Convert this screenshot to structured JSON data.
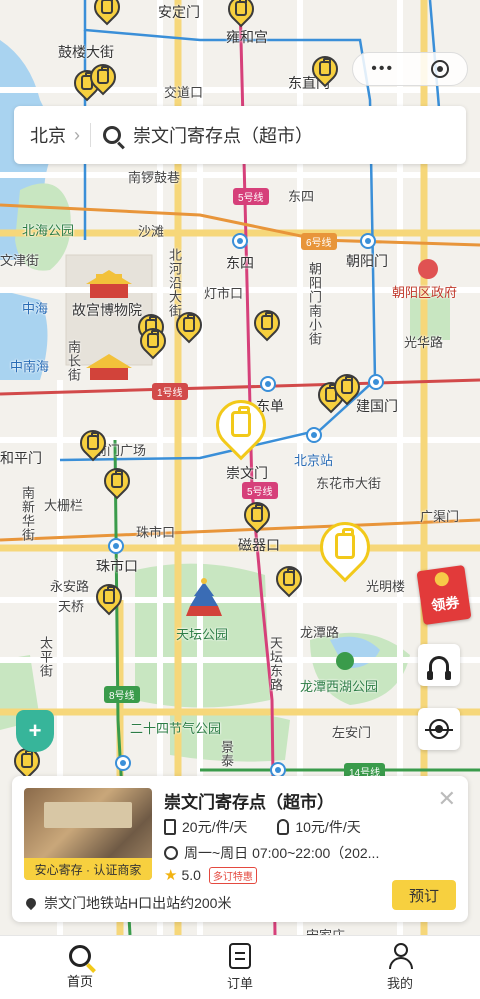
{
  "map": {
    "labels": {
      "anding_gate": "安定门",
      "yonghe_palace": "雍和宫",
      "gulou_street": "鼓楼大街",
      "jiaodaokou": "交道口",
      "dongzhimen": "东直门",
      "nanluoguxiang": "南锣鼓巷",
      "dongsi": "东四",
      "beihai_park": "北海公园",
      "shatan": "沙滩",
      "wenjin_street": "文津街",
      "beiheyan": "北河沿大街",
      "dongsi_station": "东四",
      "chaoyangmen": "朝阳门",
      "chaoyang_gov": "朝阳区政府",
      "zhonghai": "中海",
      "forbidden_city": "故宫博物院",
      "dengshikou": "灯市口",
      "chaoyangmen_nanxiaojie": "朝阳门南小街",
      "guanghualu": "光华路",
      "nanhai": "中南海",
      "nanchang_street": "南长街",
      "dongdan": "东单",
      "jianguomen": "建国门",
      "beijing_station": "北京站",
      "fuxingmen": "和平门",
      "qianmen_square": "前门广场",
      "chongwenmen": "崇文门",
      "dongbianmen": "东花市大街",
      "guangqumen": "广渠门",
      "nanxinhua": "南新华街",
      "dashilar": "大栅栏",
      "zhushikou_west": "珠市口",
      "zhushikou": "珠市口",
      "ciqikou": "磁器口",
      "yongan_road": "永安路",
      "tianqiao": "天桥",
      "guangmingqiao": "光明楼",
      "temple_of_heaven": "天坛公园",
      "longtan_road": "龙潭路",
      "taiping_street": "太平街",
      "tiantan_east": "天坛东路",
      "longtan_lake": "龙潭西湖公园",
      "jieqi_park": "二十四节气公园",
      "jingtai": "景泰",
      "zuoanmen": "左安门",
      "songjiazhuang": "宋家庄"
    },
    "subway_badges": {
      "line5_north": "5号线",
      "line6": "6号线",
      "line1": "1号线",
      "line5_south": "5号线",
      "line8": "8号线",
      "line14": "14号线"
    },
    "colors": {
      "pin_fill": "#f7d03f",
      "pin_active": "#f2c91a",
      "line1": "#d24a4a",
      "line5": "#d6407a",
      "line6": "#e8953a",
      "line8": "#3a9b4b",
      "line2": "#3a8fd8",
      "park": "#c8e6c1",
      "water": "#a9d3f0"
    }
  },
  "search": {
    "city": "北京",
    "query": "崇文门寄存点（超市）"
  },
  "coupon": {
    "label": "领券"
  },
  "card": {
    "title": "崇文门寄存点（超市）",
    "badge": "安心寄存 · 认证商家",
    "price_large": "20元/件/天",
    "price_small": "10元/件/天",
    "hours": "周一~周日 07:00~22:00（202...",
    "rating": "5.0",
    "tag": "多订特惠",
    "address": "崇文门地铁站H口出站约200米",
    "book_label": "预订"
  },
  "tabs": [
    {
      "label": "首页",
      "icon": "search-icon"
    },
    {
      "label": "订单",
      "icon": "order-icon"
    },
    {
      "label": "我的",
      "icon": "user-icon"
    }
  ]
}
